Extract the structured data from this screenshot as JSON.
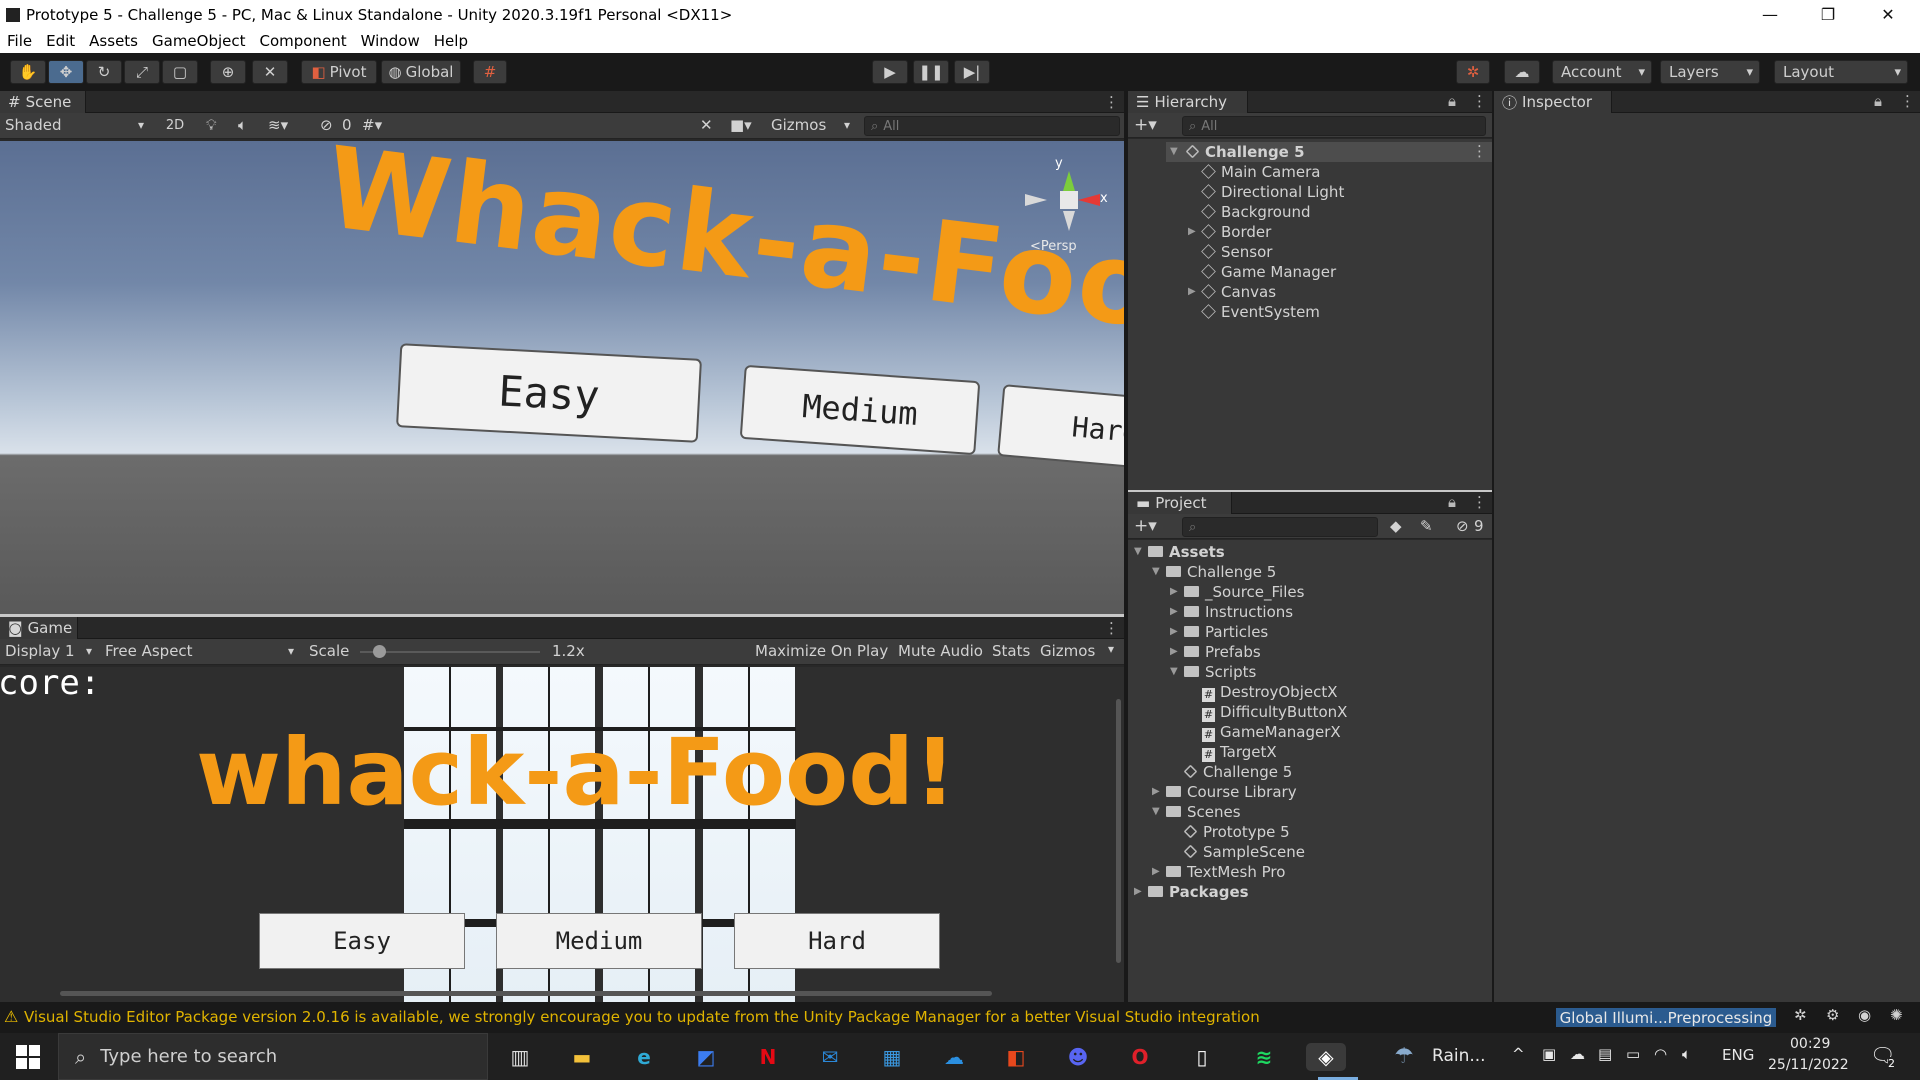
{
  "window": {
    "title": "Prototype 5 - Challenge 5 - PC, Mac & Linux Standalone - Unity 2020.3.19f1 Personal <DX11>",
    "minimize": "—",
    "restore": "❐",
    "close": "✕"
  },
  "menu": [
    "File",
    "Edit",
    "Assets",
    "GameObject",
    "Component",
    "Window",
    "Help"
  ],
  "toolbar": {
    "pivot_label": "Pivot",
    "global_label": "Global",
    "account_label": "Account",
    "layers_label": "Layers",
    "layout_label": "Layout",
    "tools": [
      "hand-tool-icon",
      "move-tool-icon",
      "rotate-tool-icon",
      "scale-tool-icon",
      "rect-tool-icon",
      "transform-tool-icon",
      "custom-tool-icon"
    ]
  },
  "scene": {
    "tab_label": "Scene",
    "shading_mode": "Shaded",
    "mode_2d": "2D",
    "hidden_count": "0",
    "gizmos_label": "Gizmos",
    "search_placeholder": "All",
    "title_text": "Whack-a-Food",
    "buttons": [
      "Easy",
      "Medium",
      "Hard"
    ],
    "axis_y": "y",
    "axis_x": "x",
    "persp_label": "<Persp"
  },
  "game": {
    "tab_label": "Game",
    "display": "Display 1",
    "aspect": "Free Aspect",
    "scale_label": "Scale",
    "scale_value": "1.2x",
    "maximize_label": "Maximize On Play",
    "mute_label": "Mute Audio",
    "stats_label": "Stats",
    "gizmos_label": "Gizmos",
    "score_text": "core:",
    "title_text": "whack-a-Food!",
    "buttons": [
      "Easy",
      "Medium",
      "Hard"
    ]
  },
  "hierarchy": {
    "tab_label": "Hierarchy",
    "search_placeholder": "All",
    "scene_name": "Challenge 5",
    "items": [
      {
        "label": "Main Camera",
        "expandable": false
      },
      {
        "label": "Directional Light",
        "expandable": false
      },
      {
        "label": "Background",
        "expandable": false
      },
      {
        "label": "Border",
        "expandable": true
      },
      {
        "label": "Sensor",
        "expandable": false
      },
      {
        "label": "Game Manager",
        "expandable": false
      },
      {
        "label": "Canvas",
        "expandable": true
      },
      {
        "label": "EventSystem",
        "expandable": false
      }
    ]
  },
  "inspector": {
    "tab_label": "Inspector"
  },
  "project": {
    "tab_label": "Project",
    "hidden_count": "9",
    "tree": [
      {
        "label": "Assets",
        "depth": 0,
        "type": "folder",
        "open": true,
        "bold": true
      },
      {
        "label": "Challenge 5",
        "depth": 1,
        "type": "folder",
        "open": true
      },
      {
        "label": "_Source_Files",
        "depth": 2,
        "type": "folder",
        "open": false
      },
      {
        "label": "Instructions",
        "depth": 2,
        "type": "folder",
        "open": false
      },
      {
        "label": "Particles",
        "depth": 2,
        "type": "folder",
        "open": false
      },
      {
        "label": "Prefabs",
        "depth": 2,
        "type": "folder",
        "open": false
      },
      {
        "label": "Scripts",
        "depth": 2,
        "type": "folder",
        "open": true
      },
      {
        "label": "DestroyObjectX",
        "depth": 3,
        "type": "script"
      },
      {
        "label": "DifficultyButtonX",
        "depth": 3,
        "type": "script"
      },
      {
        "label": "GameManagerX",
        "depth": 3,
        "type": "script"
      },
      {
        "label": "TargetX",
        "depth": 3,
        "type": "script"
      },
      {
        "label": "Challenge 5",
        "depth": 2,
        "type": "scene"
      },
      {
        "label": "Course Library",
        "depth": 1,
        "type": "folder",
        "open": false
      },
      {
        "label": "Scenes",
        "depth": 1,
        "type": "folder",
        "open": true
      },
      {
        "label": "Prototype 5",
        "depth": 2,
        "type": "scene"
      },
      {
        "label": "SampleScene",
        "depth": 2,
        "type": "scene"
      },
      {
        "label": "TextMesh Pro",
        "depth": 1,
        "type": "folder",
        "open": false
      },
      {
        "label": "Packages",
        "depth": 0,
        "type": "folder",
        "open": false,
        "bold": true
      }
    ]
  },
  "status": {
    "warning": "Visual Studio Editor Package version 2.0.16 is available, we strongly encourage you to update from the Unity Package Manager for a better Visual Studio integration",
    "progress_label": "Global Illumi...Preprocessing"
  },
  "taskbar": {
    "search_placeholder": "Type here to search",
    "weather": "Rain...",
    "language": "ENG",
    "time": "00:29",
    "date": "25/11/2022",
    "notification_count": "2",
    "apps": [
      {
        "name": "task-view-icon",
        "color": "#dddddd"
      },
      {
        "name": "file-explorer-icon",
        "color": "#f3c13a"
      },
      {
        "name": "edge-icon",
        "color": "#2fa9d4"
      },
      {
        "name": "vs-code-icon",
        "color": "#3c7df0"
      },
      {
        "name": "netflix-icon",
        "color": "#e50914"
      },
      {
        "name": "mail-icon",
        "color": "#2b88d8"
      },
      {
        "name": "store-icon",
        "color": "#3a96dd"
      },
      {
        "name": "onedrive-icon",
        "color": "#2b8fe0"
      },
      {
        "name": "office-icon",
        "color": "#e8481d"
      },
      {
        "name": "discord-icon",
        "color": "#5865f2"
      },
      {
        "name": "opera-icon",
        "color": "#e0202a"
      },
      {
        "name": "notepad-icon",
        "color": "#f5f5f5"
      },
      {
        "name": "spotify-icon",
        "color": "#1ed760"
      },
      {
        "name": "unity-icon",
        "color": "#444444"
      }
    ]
  }
}
